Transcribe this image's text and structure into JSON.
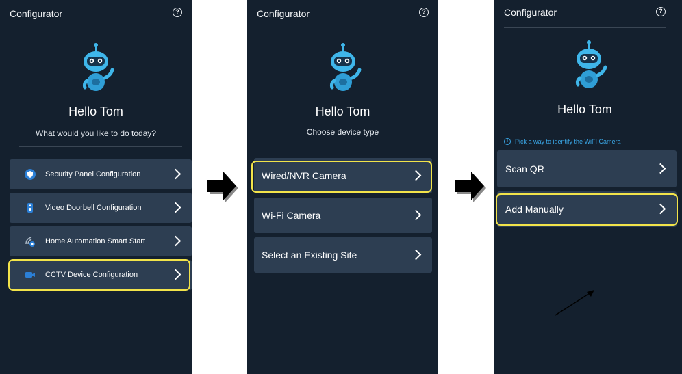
{
  "header": {
    "title": "Configurator",
    "help_icon": "question-circle-icon"
  },
  "greeting": "Hello Tom",
  "screen1": {
    "subtitle": "What would you like to do today?",
    "items": [
      {
        "label": "Security Panel Configuration",
        "icon": "shield-icon"
      },
      {
        "label": "Video Doorbell Configuration",
        "icon": "doorbell-icon"
      },
      {
        "label": "Home Automation Smart Start",
        "icon": "smart-home-icon"
      },
      {
        "label": "CCTV Device Configuration",
        "icon": "video-camera-icon"
      }
    ]
  },
  "screen2": {
    "subtitle": "Choose device type",
    "items": [
      {
        "label": "Wired/NVR Camera"
      },
      {
        "label": "Wi-Fi Camera"
      },
      {
        "label": "Select an Existing Site"
      }
    ]
  },
  "screen3": {
    "info": "Pick a way to identify the WiFI Camera",
    "items": [
      {
        "label": "Scan QR"
      },
      {
        "label": "Add Manually"
      }
    ]
  },
  "colors": {
    "background": "#14202e",
    "card": "#2d3e52",
    "highlight": "#f2e34a",
    "info": "#3aa8e8"
  }
}
